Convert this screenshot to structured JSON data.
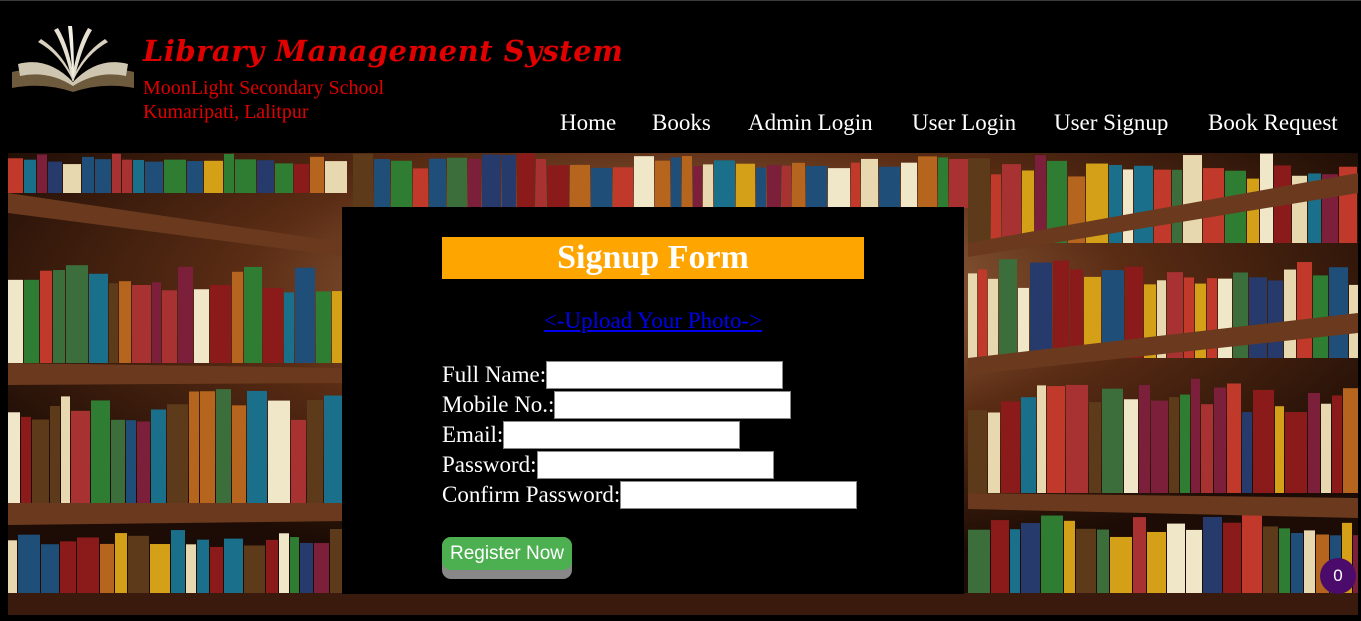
{
  "header": {
    "title": "Library Management System",
    "school": "MoonLight Secondary School",
    "location": "Kumaripati, Lalitpur",
    "logo_icon": "open-book-icon"
  },
  "nav": {
    "items": [
      {
        "label": "Home"
      },
      {
        "label": "Books"
      },
      {
        "label": "Admin Login"
      },
      {
        "label": "User Login"
      },
      {
        "label": "User Signup"
      },
      {
        "label": "Book Request"
      }
    ]
  },
  "signup": {
    "title": "Signup Form",
    "upload_link": "<-Upload Your Photo->",
    "fields": [
      {
        "label": "Full Name:",
        "value": "",
        "placeholder": ""
      },
      {
        "label": "Mobile No.:",
        "value": "",
        "placeholder": ""
      },
      {
        "label": "Email:",
        "value": "",
        "placeholder": ""
      },
      {
        "label": "Password:",
        "value": "",
        "placeholder": ""
      },
      {
        "label": "Confirm Password:",
        "value": "",
        "placeholder": ""
      }
    ],
    "submit_label": "Register Now"
  },
  "badge": {
    "count": "0"
  },
  "colors": {
    "brand_red": "#e00000",
    "title_bg": "#ffa500",
    "button_green": "#4caf50",
    "link_blue": "#0000ee",
    "badge_purple": "#4b0b6b"
  }
}
